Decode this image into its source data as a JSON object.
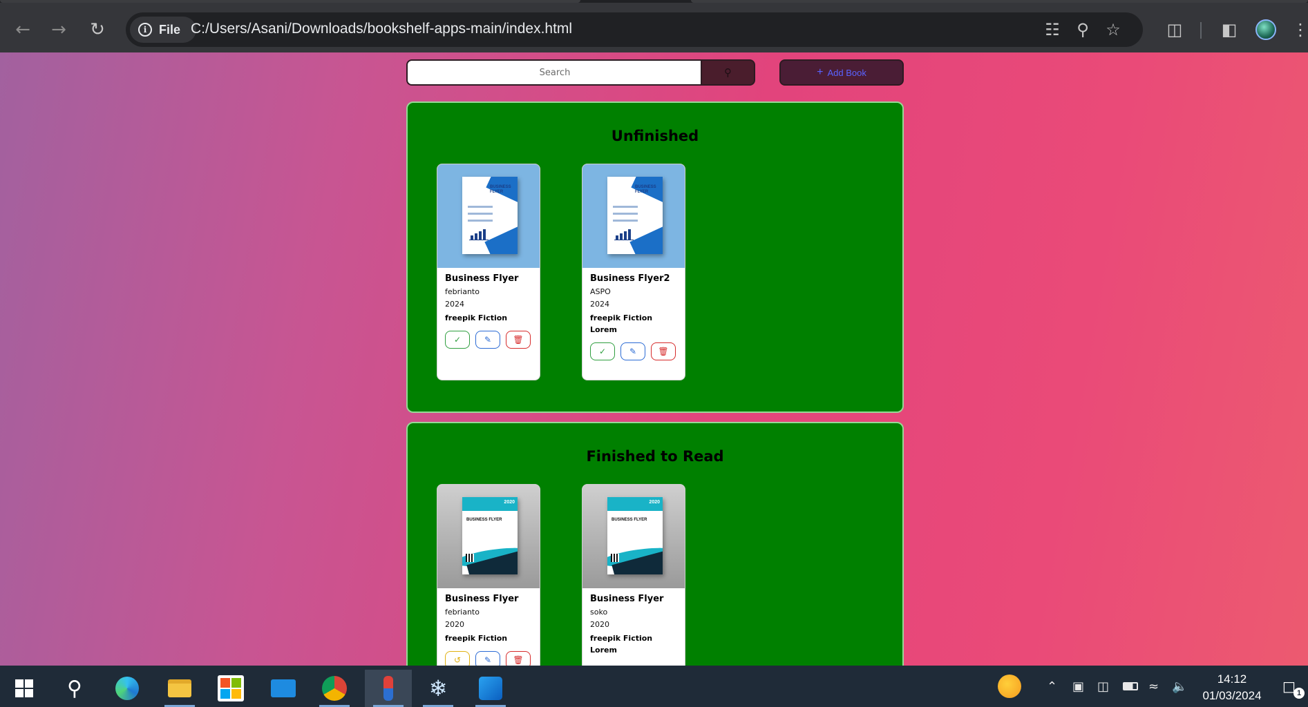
{
  "browser": {
    "back_icon": "arrow-left-icon",
    "forward_icon": "arrow-right-icon",
    "reload_icon": "reload-icon",
    "chip_label": "File",
    "url": "C:/Users/Asani/Downloads/bookshelf-apps-main/index.html"
  },
  "app": {
    "search": {
      "placeholder": "Search"
    },
    "add_book_label": "Add Book",
    "shelves": [
      {
        "title": "Unfinished",
        "books": [
          {
            "title": "Business Flyer",
            "author": "febrianto",
            "year": "2024",
            "lines": [
              "freepik Fiction"
            ],
            "cover": "business-flyer-blue"
          },
          {
            "title": "Business Flyer2",
            "author": "ASPO",
            "year": "2024",
            "lines": [
              "freepik Fiction",
              "Lorem"
            ],
            "cover": "business-flyer-blue"
          }
        ]
      },
      {
        "title": "Finished to Read",
        "books": [
          {
            "title": "Business Flyer",
            "author": "febrianto",
            "year": "2020",
            "lines": [
              "freepik Fiction"
            ],
            "cover": "business-flyer-teal"
          },
          {
            "title": "Business Flyer",
            "author": "soko",
            "year": "2020",
            "lines": [
              "freepik Fiction",
              "Lorem"
            ],
            "cover": "business-flyer-teal"
          }
        ]
      }
    ]
  },
  "taskbar": {
    "time": "14:12",
    "date": "01/03/2024",
    "notification_count": "1"
  },
  "colors": {
    "shelf_bg": "#008000",
    "add_button_text": "#5a62ff",
    "page_gradient_start": "#a2619f",
    "page_gradient_end": "#ec5a70"
  }
}
